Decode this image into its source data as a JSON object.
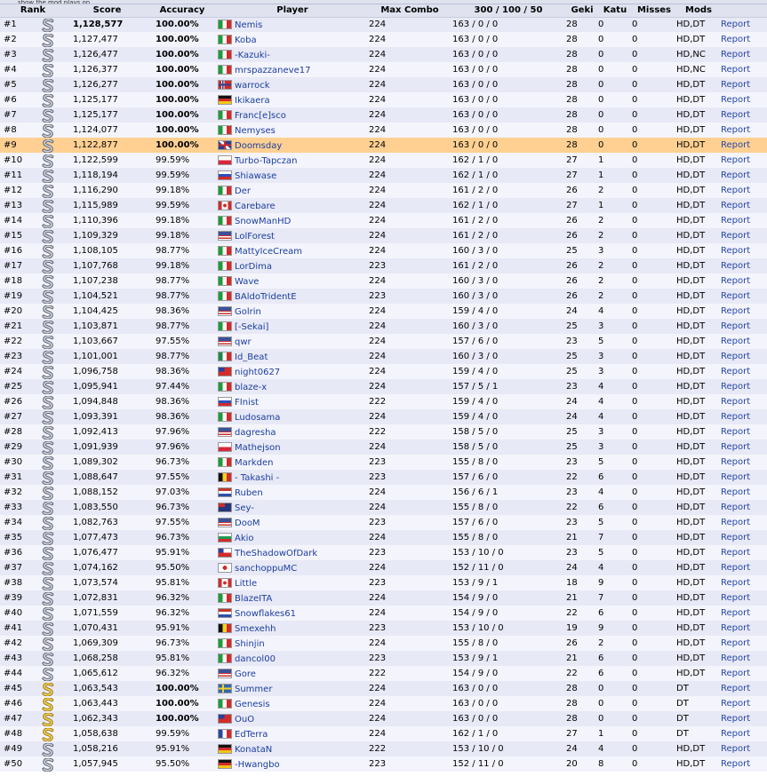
{
  "header_strip": "show the mod plays on",
  "columns": [
    "Rank",
    "Score",
    "Accuracy",
    "Player",
    "Max Combo",
    "300 / 100 / 50",
    "Geki",
    "Katu",
    "Misses",
    "Mods"
  ],
  "report_label": "Report",
  "highlight_rank": "#9",
  "rows": [
    {
      "rank": "#1",
      "grade": "S-silver",
      "score": "1,128,577",
      "accuracy": "100.00%",
      "flag": "italy",
      "player": "Nemis",
      "combo": "224",
      "hits": "163  /  0  /  0",
      "geki": "28",
      "katu": "0",
      "misses": "0",
      "mods": "HD,DT"
    },
    {
      "rank": "#2",
      "grade": "S-silver",
      "score": "1,127,477",
      "accuracy": "100.00%",
      "flag": "italy",
      "player": "Koba",
      "combo": "224",
      "hits": "163  /  0  /  0",
      "geki": "28",
      "katu": "0",
      "misses": "0",
      "mods": "HD,DT"
    },
    {
      "rank": "#3",
      "grade": "S-silver",
      "score": "1,126,477",
      "accuracy": "100.00%",
      "flag": "italy",
      "player": "-Kazuki-",
      "combo": "224",
      "hits": "163  /  0  /  0",
      "geki": "28",
      "katu": "0",
      "misses": "0",
      "mods": "HD,NC"
    },
    {
      "rank": "#4",
      "grade": "S-silver",
      "score": "1,126,377",
      "accuracy": "100.00%",
      "flag": "italy",
      "player": "mrspazzaneve17",
      "combo": "224",
      "hits": "163  /  0  /  0",
      "geki": "28",
      "katu": "0",
      "misses": "0",
      "mods": "HD,NC"
    },
    {
      "rank": "#5",
      "grade": "S-silver",
      "score": "1,126,277",
      "accuracy": "100.00%",
      "flag": "norway",
      "player": "warrock",
      "combo": "224",
      "hits": "163  /  0  /  0",
      "geki": "28",
      "katu": "0",
      "misses": "0",
      "mods": "HD,DT"
    },
    {
      "rank": "#6",
      "grade": "S-silver",
      "score": "1,125,177",
      "accuracy": "100.00%",
      "flag": "germany",
      "player": "Ikikaera",
      "combo": "224",
      "hits": "163  /  0  /  0",
      "geki": "28",
      "katu": "0",
      "misses": "0",
      "mods": "HD,DT"
    },
    {
      "rank": "#7",
      "grade": "S-silver",
      "score": "1,125,177",
      "accuracy": "100.00%",
      "flag": "italy",
      "player": "Franc[e]sco",
      "combo": "224",
      "hits": "163  /  0  /  0",
      "geki": "28",
      "katu": "0",
      "misses": "0",
      "mods": "HD,DT"
    },
    {
      "rank": "#8",
      "grade": "S-silver",
      "score": "1,124,077",
      "accuracy": "100.00%",
      "flag": "italy",
      "player": "Nemyses",
      "combo": "224",
      "hits": "163  /  0  /  0",
      "geki": "28",
      "katu": "0",
      "misses": "0",
      "mods": "HD,DT"
    },
    {
      "rank": "#9",
      "grade": "S-silver",
      "score": "1,122,877",
      "accuracy": "100.00%",
      "flag": "uk",
      "player": "Doomsday",
      "combo": "224",
      "hits": "163  /  0  /  0",
      "geki": "28",
      "katu": "0",
      "misses": "0",
      "mods": "HD,DT"
    },
    {
      "rank": "#10",
      "grade": "S-silver",
      "score": "1,122,599",
      "accuracy": "99.59%",
      "flag": "poland",
      "player": "Turbo-Tapczan",
      "combo": "224",
      "hits": "162  /  1  /  0",
      "geki": "27",
      "katu": "1",
      "misses": "0",
      "mods": "HD,DT"
    },
    {
      "rank": "#11",
      "grade": "S-silver",
      "score": "1,118,194",
      "accuracy": "99.59%",
      "flag": "russia",
      "player": "Shiawase",
      "combo": "224",
      "hits": "162  /  1  /  0",
      "geki": "27",
      "katu": "1",
      "misses": "0",
      "mods": "HD,DT"
    },
    {
      "rank": "#12",
      "grade": "S-silver",
      "score": "1,116,290",
      "accuracy": "99.18%",
      "flag": "italy",
      "player": "Der",
      "combo": "224",
      "hits": "161  /  2  /  0",
      "geki": "26",
      "katu": "2",
      "misses": "0",
      "mods": "HD,DT"
    },
    {
      "rank": "#13",
      "grade": "S-silver",
      "score": "1,115,989",
      "accuracy": "99.59%",
      "flag": "canada",
      "player": "Carebare",
      "combo": "224",
      "hits": "162  /  1  /  0",
      "geki": "27",
      "katu": "1",
      "misses": "0",
      "mods": "HD,DT"
    },
    {
      "rank": "#14",
      "grade": "S-silver",
      "score": "1,110,396",
      "accuracy": "99.18%",
      "flag": "italy",
      "player": "SnowManHD",
      "combo": "224",
      "hits": "161  /  2  /  0",
      "geki": "26",
      "katu": "2",
      "misses": "0",
      "mods": "HD,DT"
    },
    {
      "rank": "#15",
      "grade": "S-silver",
      "score": "1,109,329",
      "accuracy": "99.18%",
      "flag": "usa",
      "player": "LolForest",
      "combo": "224",
      "hits": "161  /  2  /  0",
      "geki": "26",
      "katu": "2",
      "misses": "0",
      "mods": "HD,DT"
    },
    {
      "rank": "#16",
      "grade": "S-silver",
      "score": "1,108,105",
      "accuracy": "98.77%",
      "flag": "italy",
      "player": "MattyIceCream",
      "combo": "224",
      "hits": "160  /  3  /  0",
      "geki": "25",
      "katu": "3",
      "misses": "0",
      "mods": "HD,DT"
    },
    {
      "rank": "#17",
      "grade": "S-silver",
      "score": "1,107,768",
      "accuracy": "99.18%",
      "flag": "italy",
      "player": "LorDima",
      "combo": "223",
      "hits": "161  /  2  /  0",
      "geki": "26",
      "katu": "2",
      "misses": "0",
      "mods": "HD,DT"
    },
    {
      "rank": "#18",
      "grade": "S-silver",
      "score": "1,107,238",
      "accuracy": "98.77%",
      "flag": "italy",
      "player": "Wave",
      "combo": "224",
      "hits": "160  /  3  /  0",
      "geki": "26",
      "katu": "2",
      "misses": "0",
      "mods": "HD,DT"
    },
    {
      "rank": "#19",
      "grade": "S-silver",
      "score": "1,104,521",
      "accuracy": "98.77%",
      "flag": "italy",
      "player": "BAldoTridentE",
      "combo": "223",
      "hits": "160  /  3  /  0",
      "geki": "26",
      "katu": "2",
      "misses": "0",
      "mods": "HD,DT"
    },
    {
      "rank": "#20",
      "grade": "S-silver",
      "score": "1,104,425",
      "accuracy": "98.36%",
      "flag": "usa",
      "player": "Golrin",
      "combo": "224",
      "hits": "159  /  4  /  0",
      "geki": "24",
      "katu": "4",
      "misses": "0",
      "mods": "HD,DT"
    },
    {
      "rank": "#21",
      "grade": "S-silver",
      "score": "1,103,871",
      "accuracy": "98.77%",
      "flag": "italy",
      "player": "[-Sekai]",
      "combo": "224",
      "hits": "160  /  3  /  0",
      "geki": "25",
      "katu": "3",
      "misses": "0",
      "mods": "HD,DT"
    },
    {
      "rank": "#22",
      "grade": "S-silver",
      "score": "1,103,667",
      "accuracy": "97.55%",
      "flag": "usa",
      "player": "qwr",
      "combo": "224",
      "hits": "157  /  6  /  0",
      "geki": "23",
      "katu": "5",
      "misses": "0",
      "mods": "HD,DT"
    },
    {
      "rank": "#23",
      "grade": "S-silver",
      "score": "1,101,001",
      "accuracy": "98.77%",
      "flag": "mexico",
      "player": "Id_Beat",
      "combo": "224",
      "hits": "160  /  3  /  0",
      "geki": "25",
      "katu": "3",
      "misses": "0",
      "mods": "HD,DT"
    },
    {
      "rank": "#24",
      "grade": "S-silver",
      "score": "1,096,758",
      "accuracy": "98.36%",
      "flag": "taiwan",
      "player": "night0627",
      "combo": "224",
      "hits": "159  /  4  /  0",
      "geki": "25",
      "katu": "3",
      "misses": "0",
      "mods": "HD,DT"
    },
    {
      "rank": "#25",
      "grade": "S-silver",
      "score": "1,095,941",
      "accuracy": "97.44%",
      "flag": "italy",
      "player": "blaze-x",
      "combo": "224",
      "hits": "157  /  5  /  1",
      "geki": "23",
      "katu": "4",
      "misses": "0",
      "mods": "HD,DT"
    },
    {
      "rank": "#26",
      "grade": "S-silver",
      "score": "1,094,848",
      "accuracy": "98.36%",
      "flag": "russia",
      "player": "FInist",
      "combo": "222",
      "hits": "159  /  4  /  0",
      "geki": "24",
      "katu": "4",
      "misses": "0",
      "mods": "HD,DT"
    },
    {
      "rank": "#27",
      "grade": "S-silver",
      "score": "1,093,391",
      "accuracy": "98.36%",
      "flag": "italy",
      "player": "Ludosama",
      "combo": "224",
      "hits": "159  /  4  /  0",
      "geki": "24",
      "katu": "4",
      "misses": "0",
      "mods": "HD,DT"
    },
    {
      "rank": "#28",
      "grade": "S-silver",
      "score": "1,092,413",
      "accuracy": "97.96%",
      "flag": "usa",
      "player": "dagresha",
      "combo": "222",
      "hits": "158  /  5  /  0",
      "geki": "25",
      "katu": "3",
      "misses": "0",
      "mods": "HD,DT"
    },
    {
      "rank": "#29",
      "grade": "S-silver",
      "score": "1,091,939",
      "accuracy": "97.96%",
      "flag": "poland",
      "player": "Mathejson",
      "combo": "224",
      "hits": "158  /  5  /  0",
      "geki": "25",
      "katu": "3",
      "misses": "0",
      "mods": "HD,DT"
    },
    {
      "rank": "#30",
      "grade": "S-silver",
      "score": "1,089,302",
      "accuracy": "96.73%",
      "flag": "italy",
      "player": "Markden",
      "combo": "223",
      "hits": "155  /  8  /  0",
      "geki": "23",
      "katu": "5",
      "misses": "0",
      "mods": "HD,DT"
    },
    {
      "rank": "#31",
      "grade": "S-silver",
      "score": "1,088,647",
      "accuracy": "97.55%",
      "flag": "belgium",
      "player": "- Takashi -",
      "combo": "223",
      "hits": "157  /  6  /  0",
      "geki": "22",
      "katu": "6",
      "misses": "0",
      "mods": "HD,DT"
    },
    {
      "rank": "#32",
      "grade": "S-silver",
      "score": "1,088,152",
      "accuracy": "97.03%",
      "flag": "netherlands",
      "player": "Ruben",
      "combo": "224",
      "hits": "156  /  6  /  1",
      "geki": "23",
      "katu": "4",
      "misses": "0",
      "mods": "HD,DT"
    },
    {
      "rank": "#33",
      "grade": "S-silver",
      "score": "1,083,550",
      "accuracy": "96.73%",
      "flag": "australia",
      "player": "Sey-",
      "combo": "224",
      "hits": "155  /  8  /  0",
      "geki": "22",
      "katu": "6",
      "misses": "0",
      "mods": "HD,DT"
    },
    {
      "rank": "#34",
      "grade": "S-silver",
      "score": "1,082,763",
      "accuracy": "97.55%",
      "flag": "usa",
      "player": "DooM",
      "combo": "223",
      "hits": "157  /  6  /  0",
      "geki": "23",
      "katu": "5",
      "misses": "0",
      "mods": "HD,DT"
    },
    {
      "rank": "#35",
      "grade": "S-silver",
      "score": "1,077,473",
      "accuracy": "96.73%",
      "flag": "bulgaria",
      "player": "Akio",
      "combo": "224",
      "hits": "155  /  8  /  0",
      "geki": "21",
      "katu": "7",
      "misses": "0",
      "mods": "HD,DT"
    },
    {
      "rank": "#36",
      "grade": "S-silver",
      "score": "1,076,477",
      "accuracy": "95.91%",
      "flag": "chile",
      "player": "TheShadowOfDark",
      "combo": "223",
      "hits": "153  /  10  /  0",
      "geki": "23",
      "katu": "5",
      "misses": "0",
      "mods": "HD,DT"
    },
    {
      "rank": "#37",
      "grade": "S-silver",
      "score": "1,074,162",
      "accuracy": "95.50%",
      "flag": "japan",
      "player": "sanchoppuMC",
      "combo": "224",
      "hits": "152  /  11  /  0",
      "geki": "24",
      "katu": "4",
      "misses": "0",
      "mods": "HD,DT"
    },
    {
      "rank": "#38",
      "grade": "S-silver",
      "score": "1,073,574",
      "accuracy": "95.81%",
      "flag": "canada",
      "player": "Little",
      "combo": "223",
      "hits": "153  /  9  /  1",
      "geki": "18",
      "katu": "9",
      "misses": "0",
      "mods": "HD,DT"
    },
    {
      "rank": "#39",
      "grade": "S-silver",
      "score": "1,072,831",
      "accuracy": "96.32%",
      "flag": "italy",
      "player": "BlazeITA",
      "combo": "224",
      "hits": "154  /  9  /  0",
      "geki": "21",
      "katu": "7",
      "misses": "0",
      "mods": "HD,DT"
    },
    {
      "rank": "#40",
      "grade": "S-silver",
      "score": "1,071,559",
      "accuracy": "96.32%",
      "flag": "netherlands",
      "player": "Snowflakes61",
      "combo": "224",
      "hits": "154  /  9  /  0",
      "geki": "22",
      "katu": "6",
      "misses": "0",
      "mods": "HD,DT"
    },
    {
      "rank": "#41",
      "grade": "S-silver",
      "score": "1,070,431",
      "accuracy": "95.91%",
      "flag": "belgium",
      "player": "Smexehh",
      "combo": "223",
      "hits": "153  /  10  /  0",
      "geki": "19",
      "katu": "9",
      "misses": "0",
      "mods": "HD,DT"
    },
    {
      "rank": "#42",
      "grade": "S-silver",
      "score": "1,069,309",
      "accuracy": "96.73%",
      "flag": "italy",
      "player": "Shinjin",
      "combo": "224",
      "hits": "155  /  8  /  0",
      "geki": "26",
      "katu": "2",
      "misses": "0",
      "mods": "HD,DT"
    },
    {
      "rank": "#43",
      "grade": "S-silver",
      "score": "1,068,258",
      "accuracy": "95.81%",
      "flag": "italy",
      "player": "dancol00",
      "combo": "223",
      "hits": "153  /  9  /  1",
      "geki": "21",
      "katu": "6",
      "misses": "0",
      "mods": "HD,DT"
    },
    {
      "rank": "#44",
      "grade": "S-silver",
      "score": "1,065,612",
      "accuracy": "96.32%",
      "flag": "usa",
      "player": "Gore",
      "combo": "222",
      "hits": "154  /  9  /  0",
      "geki": "22",
      "katu": "6",
      "misses": "0",
      "mods": "HD,DT"
    },
    {
      "rank": "#45",
      "grade": "S-gold",
      "score": "1,063,543",
      "accuracy": "100.00%",
      "flag": "sweden",
      "player": "Summer",
      "combo": "224",
      "hits": "163  /  0  /  0",
      "geki": "28",
      "katu": "0",
      "misses": "0",
      "mods": "DT"
    },
    {
      "rank": "#46",
      "grade": "S-gold",
      "score": "1,063,443",
      "accuracy": "100.00%",
      "flag": "italy",
      "player": "Genesis",
      "combo": "224",
      "hits": "163  /  0  /  0",
      "geki": "28",
      "katu": "0",
      "misses": "0",
      "mods": "DT"
    },
    {
      "rank": "#47",
      "grade": "S-gold",
      "score": "1,062,343",
      "accuracy": "100.00%",
      "flag": "taiwan",
      "player": "OuO",
      "combo": "224",
      "hits": "163  /  0  /  0",
      "geki": "28",
      "katu": "0",
      "misses": "0",
      "mods": "DT"
    },
    {
      "rank": "#48",
      "grade": "S-gold",
      "score": "1,058,638",
      "accuracy": "99.59%",
      "flag": "france",
      "player": "EdTerra",
      "combo": "224",
      "hits": "162  /  1  /  0",
      "geki": "27",
      "katu": "1",
      "misses": "0",
      "mods": "DT"
    },
    {
      "rank": "#49",
      "grade": "S-silver",
      "score": "1,058,216",
      "accuracy": "95.91%",
      "flag": "germany",
      "player": "KonataN",
      "combo": "222",
      "hits": "153  /  10  /  0",
      "geki": "24",
      "katu": "4",
      "misses": "0",
      "mods": "HD,DT"
    },
    {
      "rank": "#50",
      "grade": "S-silver",
      "score": "1,057,945",
      "accuracy": "95.50%",
      "flag": "germany",
      "player": "-Hwangbo",
      "combo": "223",
      "hits": "152  /  11  /  0",
      "geki": "20",
      "katu": "8",
      "misses": "0",
      "mods": "HD,DT"
    }
  ],
  "colors": {
    "highlight_row": "#ffd092",
    "row_odd": "#e8e9f6",
    "row_even": "#f4f4fc",
    "header_bg": "#e0e3ef",
    "link": "#1a3ea0"
  }
}
